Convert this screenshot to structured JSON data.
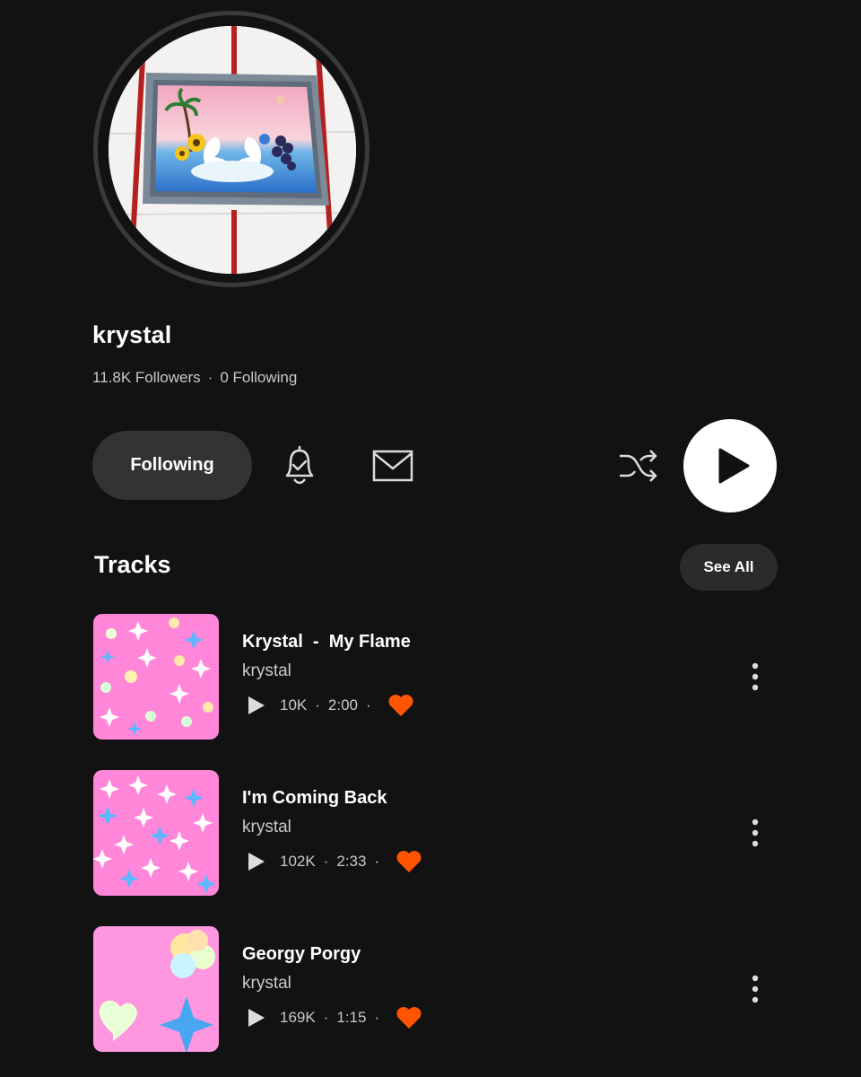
{
  "profile": {
    "username": "krystal",
    "followers": "11.8K Followers",
    "following": "0 Following",
    "separator": "·"
  },
  "actions": {
    "following_label": "Following",
    "icons": [
      "bell-check-icon",
      "mail-icon",
      "shuffle-icon",
      "play-icon"
    ]
  },
  "tracks_section": {
    "title": "Tracks",
    "see_all_label": "See All"
  },
  "tracks": [
    {
      "title": "Krystal  -  My Flame",
      "artist": "krystal",
      "plays": "10K",
      "duration": "2:00",
      "liked": true
    },
    {
      "title": "I'm Coming Back",
      "artist": "krystal",
      "plays": "102K",
      "duration": "2:33",
      "liked": true
    },
    {
      "title": "Georgy Porgy",
      "artist": "krystal",
      "plays": "169K",
      "duration": "1:15",
      "liked": true
    }
  ],
  "colors": {
    "background": "#121212",
    "accent_heart": "#ff5500",
    "artwork_pink": "#ff7fd6",
    "button_gray": "#333333"
  }
}
